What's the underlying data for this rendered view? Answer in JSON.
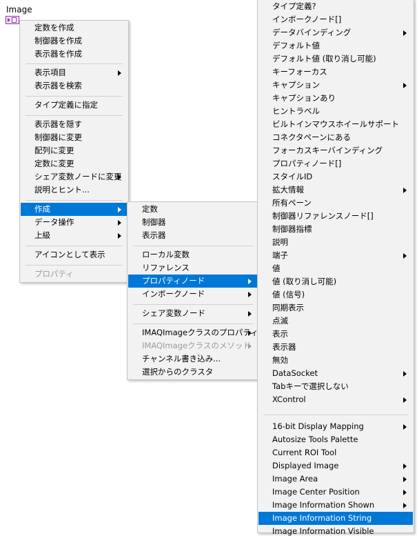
{
  "terminal": {
    "label": "Image"
  },
  "menu1": {
    "items": [
      {
        "label": "定数を作成"
      },
      {
        "label": "制御器を作成"
      },
      {
        "label": "表示器を作成"
      },
      {
        "label": "表示項目",
        "submenu": true
      },
      {
        "label": "表示器を検索"
      },
      {
        "label": "タイプ定義に指定"
      },
      {
        "label": "表示器を隠す"
      },
      {
        "label": "制御器に変更"
      },
      {
        "label": "配列に変更"
      },
      {
        "label": "定数に変更"
      },
      {
        "label": "シェア変数ノードに変更",
        "submenu": true
      },
      {
        "label": "説明とヒント..."
      },
      {
        "label": "作成",
        "submenu": true,
        "selected": true
      },
      {
        "label": "データ操作",
        "submenu": true
      },
      {
        "label": "上級",
        "submenu": true
      },
      {
        "label": "アイコンとして表示"
      },
      {
        "label": "プロパティ",
        "disabled": true
      }
    ]
  },
  "menu2": {
    "items": [
      {
        "label": "定数"
      },
      {
        "label": "制御器"
      },
      {
        "label": "表示器"
      },
      {
        "label": "ローカル変数"
      },
      {
        "label": "リファレンス"
      },
      {
        "label": "プロパティノード",
        "submenu": true,
        "selected": true
      },
      {
        "label": "インボークノード",
        "submenu": true
      },
      {
        "label": "シェア変数ノード",
        "submenu": true
      },
      {
        "label": "IMAQImageクラスのプロパティ",
        "submenu": true
      },
      {
        "label": "IMAQImageクラスのメソッド",
        "submenu": true,
        "disabled": true
      },
      {
        "label": "チャンネル書き込み..."
      },
      {
        "label": "選択からのクラスタ"
      }
    ]
  },
  "menu3": {
    "items": [
      {
        "label": "タイプ定義?"
      },
      {
        "label": "インボークノード[]"
      },
      {
        "label": "データバインディング",
        "submenu": true
      },
      {
        "label": "デフォルト値"
      },
      {
        "label": "デフォルト値 (取り消し可能)"
      },
      {
        "label": "キーフォーカス"
      },
      {
        "label": "キャプション",
        "submenu": true
      },
      {
        "label": "キャプションあり"
      },
      {
        "label": "ヒントラベル"
      },
      {
        "label": "ビルトインマウスホイールサポート"
      },
      {
        "label": "コネクタペーンにある"
      },
      {
        "label": "フォーカスキーバインディング"
      },
      {
        "label": "プロパティノード[]"
      },
      {
        "label": "スタイルID"
      },
      {
        "label": "拡大情報",
        "submenu": true
      },
      {
        "label": "所有ペーン"
      },
      {
        "label": "制御器リファレンスノード[]"
      },
      {
        "label": "制御器指標"
      },
      {
        "label": "説明"
      },
      {
        "label": "端子",
        "submenu": true
      },
      {
        "label": "値"
      },
      {
        "label": "値 (取り消し可能)"
      },
      {
        "label": "値 (信号)"
      },
      {
        "label": "同期表示"
      },
      {
        "label": "点滅"
      },
      {
        "label": "表示"
      },
      {
        "label": "表示器"
      },
      {
        "label": "無効"
      },
      {
        "label": "DataSocket",
        "submenu": true
      },
      {
        "label": "Tabキーで選択しない"
      },
      {
        "label": "XControl",
        "submenu": true
      },
      {
        "label": "16-bit Display Mapping",
        "submenu": true
      },
      {
        "label": "Autosize Tools Palette"
      },
      {
        "label": "Current ROI Tool"
      },
      {
        "label": "Displayed Image",
        "submenu": true
      },
      {
        "label": "Image Area",
        "submenu": true
      },
      {
        "label": "Image Center Position",
        "submenu": true
      },
      {
        "label": "Image Information Shown",
        "submenu": true
      },
      {
        "label": "Image Information String",
        "selected": true
      },
      {
        "label": "Image Information Visible"
      }
    ]
  }
}
